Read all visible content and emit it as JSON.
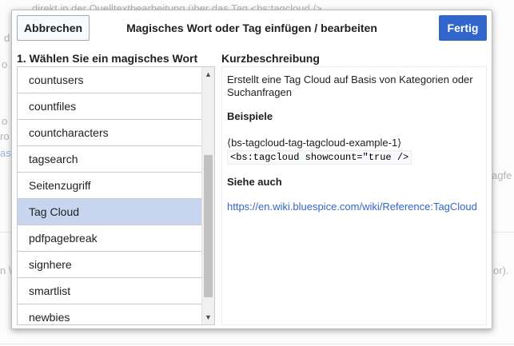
{
  "background": {
    "snippets": [
      "direkt in der Quelltextbearbeitung über das Tag <bs:tagcloud />.",
      "o",
      "d",
      "o",
      "ro",
      "ase",
      "agfe",
      "n \\",
      "or)."
    ]
  },
  "dialog": {
    "cancel_label": "Abbrechen",
    "title": "Magisches Wort oder Tag einfügen / bearbeiten",
    "done_label": "Fertig"
  },
  "list": {
    "heading": "1. Wählen Sie ein magisches Wort",
    "items": [
      {
        "label": "countusers"
      },
      {
        "label": "countfiles"
      },
      {
        "label": "countcharacters"
      },
      {
        "label": "tagsearch"
      },
      {
        "label": "Seitenzugriff"
      },
      {
        "label": "Tag Cloud"
      },
      {
        "label": "pdfpagebreak"
      },
      {
        "label": "signhere"
      },
      {
        "label": "smartlist"
      },
      {
        "label": "newbies"
      }
    ],
    "selected_index": 5
  },
  "description": {
    "heading": "Kurzbeschreibung",
    "text": "Erstellt eine Tag Cloud auf Basis von Kategorien oder Suchanfragen",
    "examples_heading": "Beispiele",
    "example_name": "⟨bs-tagcloud-tag-tagcloud-example-1⟩",
    "example_code": "<bs:tagcloud showcount=\"true />",
    "see_also_heading": "Siehe auch",
    "see_also_link": "https://en.wiki.bluespice.com/wiki/Reference:TagCloud"
  },
  "colors": {
    "primary": "#3366cc",
    "selected_row": "#c7d6ee",
    "link": "#3366cc"
  }
}
